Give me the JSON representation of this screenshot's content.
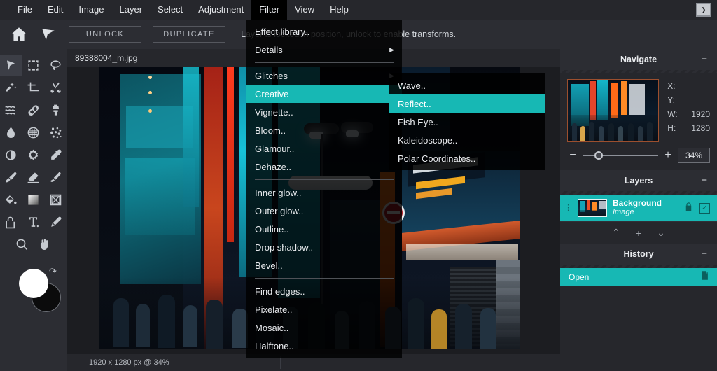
{
  "menubar": {
    "items": [
      {
        "label": "File",
        "active": false
      },
      {
        "label": "Edit",
        "active": false
      },
      {
        "label": "Image",
        "active": false
      },
      {
        "label": "Layer",
        "active": false
      },
      {
        "label": "Select",
        "active": false
      },
      {
        "label": "Adjustment",
        "active": false
      },
      {
        "label": "Filter",
        "active": true
      },
      {
        "label": "View",
        "active": false
      },
      {
        "label": "Help",
        "active": false
      }
    ],
    "console_icon": "console-icon",
    "console_glyph": "❯"
  },
  "optionbar": {
    "home_icon": "home-icon",
    "move_icon": "move-cursor-icon",
    "unlock_label": "UNLOCK",
    "duplicate_label": "DUPLICATE",
    "status_message": "Layer is locked in position, unlock to enable transforms."
  },
  "tools": {
    "items": [
      {
        "name": "move-tool",
        "selected": true
      },
      {
        "name": "marquee-select-tool",
        "selected": false
      },
      {
        "name": "lasso-tool",
        "selected": false
      },
      {
        "name": "magic-wand-tool",
        "selected": false
      },
      {
        "name": "crop-tool",
        "selected": false
      },
      {
        "name": "scissors-cut-tool",
        "selected": false
      },
      {
        "name": "liquify-tool",
        "selected": false
      },
      {
        "name": "healing-patch-tool",
        "selected": false
      },
      {
        "name": "clone-stamp-tool",
        "selected": false
      },
      {
        "name": "blur-drop-tool",
        "selected": false
      },
      {
        "name": "halftone-grid-tool",
        "selected": false
      },
      {
        "name": "dither-noise-tool",
        "selected": false
      },
      {
        "name": "contrast-tool",
        "selected": false
      },
      {
        "name": "sharpen-sun-tool",
        "selected": false
      },
      {
        "name": "eyedropper-tool",
        "selected": false
      },
      {
        "name": "paintbrush-tool",
        "selected": false
      },
      {
        "name": "eraser-tool",
        "selected": false
      },
      {
        "name": "smudge-tool",
        "selected": false
      },
      {
        "name": "paint-bucket-tool",
        "selected": false
      },
      {
        "name": "gradient-tool",
        "selected": false
      },
      {
        "name": "shape-tool",
        "selected": false
      },
      {
        "name": "lock-transform-tool",
        "selected": false
      },
      {
        "name": "text-tool",
        "selected": false
      },
      {
        "name": "pen-tool",
        "selected": false
      }
    ],
    "bottom": [
      {
        "name": "zoom-magnifier-tool",
        "selected": false
      },
      {
        "name": "hand-pan-tool",
        "selected": false
      }
    ],
    "foreground_color": "#ffffff",
    "background_color": "#0b0b0c",
    "swap_icon": "swap-colors-icon"
  },
  "document": {
    "tab_label": "89388004_m.jpg",
    "status_size": "1920 x 1280 px @ 34%"
  },
  "filter_menu": {
    "items": [
      {
        "label": "Effect library..",
        "submenu": false,
        "highlight": false,
        "divider_after": false
      },
      {
        "label": "Details",
        "submenu": true,
        "highlight": false,
        "divider_after": true
      },
      {
        "label": "Glitches",
        "submenu": true,
        "highlight": false,
        "divider_after": false
      },
      {
        "label": "Creative",
        "submenu": true,
        "highlight": true,
        "divider_after": false
      },
      {
        "label": "Vignette..",
        "submenu": false,
        "highlight": false,
        "divider_after": false
      },
      {
        "label": "Bloom..",
        "submenu": false,
        "highlight": false,
        "divider_after": false
      },
      {
        "label": "Glamour..",
        "submenu": false,
        "highlight": false,
        "divider_after": false
      },
      {
        "label": "Dehaze..",
        "submenu": false,
        "highlight": false,
        "divider_after": true
      },
      {
        "label": "Inner glow..",
        "submenu": false,
        "highlight": false,
        "divider_after": false
      },
      {
        "label": "Outer glow..",
        "submenu": false,
        "highlight": false,
        "divider_after": false
      },
      {
        "label": "Outline..",
        "submenu": false,
        "highlight": false,
        "divider_after": false
      },
      {
        "label": "Drop shadow..",
        "submenu": false,
        "highlight": false,
        "divider_after": false
      },
      {
        "label": "Bevel..",
        "submenu": false,
        "highlight": false,
        "divider_after": true
      },
      {
        "label": "Find edges..",
        "submenu": false,
        "highlight": false,
        "divider_after": false
      },
      {
        "label": "Pixelate..",
        "submenu": false,
        "highlight": false,
        "divider_after": false
      },
      {
        "label": "Mosaic..",
        "submenu": false,
        "highlight": false,
        "divider_after": false
      },
      {
        "label": "Halftone..",
        "submenu": false,
        "highlight": false,
        "divider_after": false
      }
    ],
    "submenu_title": "Creative",
    "submenu_items": [
      {
        "label": "Wave..",
        "highlight": false
      },
      {
        "label": "Reflect..",
        "highlight": true
      },
      {
        "label": "Fish Eye..",
        "highlight": false
      },
      {
        "label": "Kaleidoscope..",
        "highlight": false
      },
      {
        "label": "Polar Coordinates..",
        "highlight": false
      }
    ]
  },
  "navigate_panel": {
    "title": "Navigate",
    "minimize_icon": "minimize-icon",
    "fields": [
      {
        "key": "X:",
        "value": ""
      },
      {
        "key": "Y:",
        "value": ""
      },
      {
        "key": "W:",
        "value": "1920"
      },
      {
        "key": "H:",
        "value": "1280"
      }
    ],
    "zoom_minus": "−",
    "zoom_plus": "+",
    "zoom_value": "34%",
    "slider_position_pct": 16
  },
  "layers_panel": {
    "title": "Layers",
    "minimize_icon": "minimize-icon",
    "layers": [
      {
        "name": "Background",
        "type": "Image",
        "locked": true,
        "visible": true,
        "selected": true
      }
    ],
    "actions": [
      {
        "name": "move-layer-up-button",
        "glyph": "⌃"
      },
      {
        "name": "add-layer-button",
        "glyph": "+"
      },
      {
        "name": "move-layer-down-button",
        "glyph": "⌄"
      }
    ]
  },
  "history_panel": {
    "title": "History",
    "minimize_icon": "minimize-icon",
    "entries": [
      {
        "label": "Open",
        "icon": "document-icon",
        "selected": true
      }
    ]
  },
  "theme": {
    "accent": "#17b8b4",
    "panel_bg": "#26272c",
    "toolbar_bg": "#2c2d33",
    "canvas_bg": "#1c1d21",
    "menu_bg": "rgba(0,0,0,0.82)",
    "text": "#e4e6e9"
  }
}
